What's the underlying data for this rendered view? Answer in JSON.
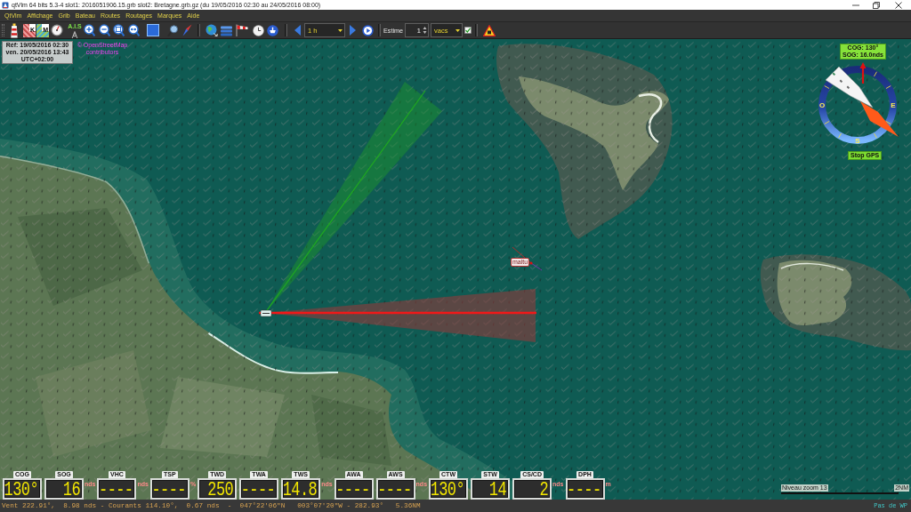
{
  "window": {
    "title": "qtVlm 64 bits 5.3-4 slot1: 2016051906.15.grb slot2: Bretagne.grb.gz (du 19/05/2016 02:30 au 24/05/2016 08:00)"
  },
  "menu": [
    "QtVlm",
    "Affichage",
    "Grib",
    "Bateau",
    "Routes",
    "Routages",
    "Marques",
    "Aide"
  ],
  "toolbar": {
    "chart_letters": [
      "K",
      "M"
    ],
    "ais_label": "A.I.S",
    "time_step": "1 h",
    "estimate_label": "Estime",
    "estimate_count": "1",
    "estimate_unit": "vacs",
    "estimate_checkbox": {
      "checked": true
    }
  },
  "map": {
    "time_info": [
      "Réf: 19/05/2016 02:30",
      "ven. 20/05/2016 13:43",
      "UTC+02:00"
    ],
    "attribution": "© OpenStreetMap contributors",
    "mark_label": "maltu",
    "compass": {
      "readout": [
        "COG: 130°",
        "SOG: 16.0nds"
      ],
      "cardinals": [
        "E",
        "S",
        "O"
      ],
      "gps_button": "Stop GPS"
    },
    "zoom_level": "Niveau zoom 13",
    "scale": "2NM"
  },
  "instruments": [
    {
      "label": "COG",
      "value": "130°"
    },
    {
      "label": "SOG",
      "value": "16",
      "unit": "nds"
    },
    {
      "label": "VHC",
      "value": "----",
      "unit": "nds"
    },
    {
      "label": "TSP",
      "value": "----",
      "unit": "%"
    },
    {
      "label": "TWD",
      "value": "250"
    },
    {
      "label": "TWA",
      "value": "----"
    },
    {
      "label": "TWS",
      "value": "14.8",
      "unit": "nds"
    },
    {
      "label": "AWA",
      "value": "----"
    },
    {
      "label": "AWS",
      "value": "----",
      "unit": "nds"
    },
    {
      "label": "CTW",
      "value": "130°"
    },
    {
      "label": "STW",
      "value": "14"
    },
    {
      "label": "CS/CD",
      "value": "2",
      "unit": "nds"
    },
    {
      "label": "DPH",
      "value": "----",
      "unit": "m"
    }
  ],
  "status_bar": {
    "position": "Vent 222.91°,  8.98 nds - Courants 114.10°,  0.67 nds  -  047°22'06\"N   003°07'20\"W - 282.93°   5.36NM",
    "waypoint": "Pas de WP"
  }
}
